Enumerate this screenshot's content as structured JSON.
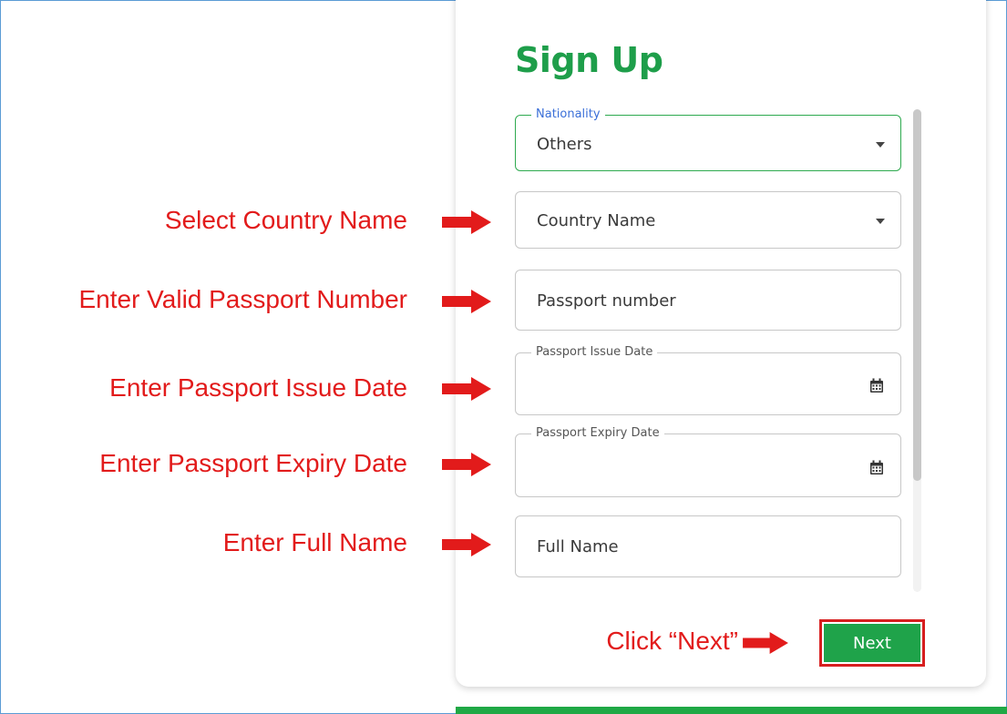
{
  "form": {
    "title": "Sign Up",
    "nationality": {
      "label": "Nationality",
      "value": "Others"
    },
    "country": {
      "placeholder": "Country Name"
    },
    "passport_number": {
      "placeholder": "Passport number"
    },
    "issue_date": {
      "label": "Passport Issue Date",
      "value": ""
    },
    "expiry_date": {
      "label": "Passport Expiry Date",
      "value": ""
    },
    "full_name": {
      "placeholder": "Full Name"
    },
    "next_label": "Next"
  },
  "annotations": {
    "country": "Select Country Name",
    "passport_number": "Enter Valid Passport Number",
    "issue_date": "Enter Passport Issue Date",
    "expiry_date": "Enter Passport Expiry Date",
    "full_name": "Enter Full Name",
    "next": "Click “Next”"
  },
  "icons": {
    "dropdown": "chevron-down-icon",
    "date": "calendar-icon",
    "annotation": "arrow-right-icon"
  },
  "colors": {
    "brand_green": "#1e9e4a",
    "annotation_red": "#e21b1b",
    "label_blue": "#3a6fd8"
  }
}
